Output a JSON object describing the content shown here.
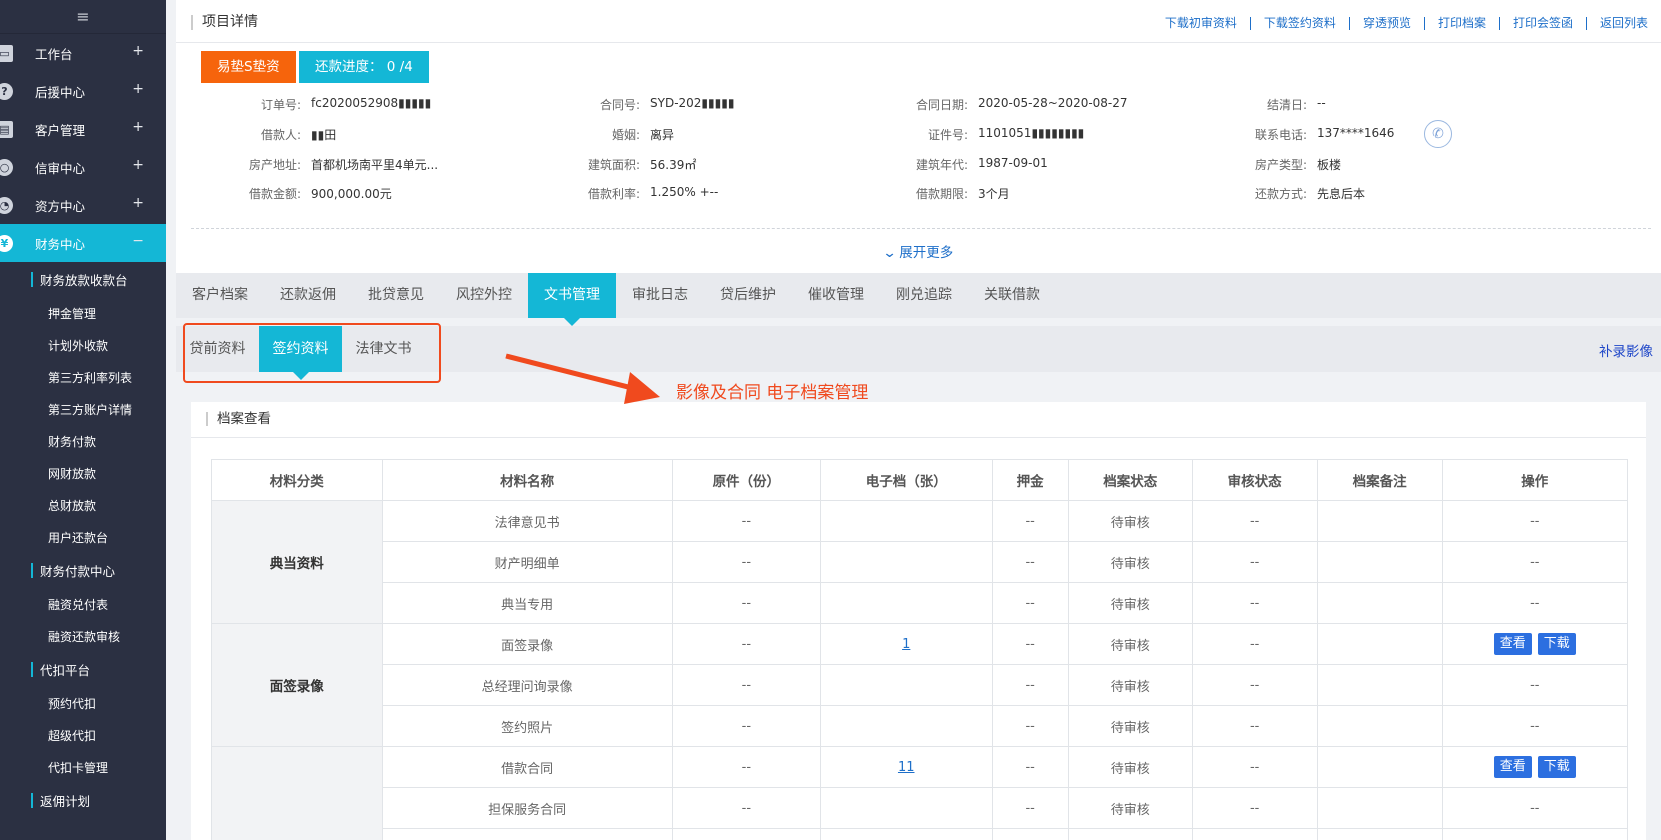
{
  "sidebar": {
    "toggle_icon": "hamburger-icon",
    "menus": [
      {
        "label": "工作台",
        "icon": "monitor-icon",
        "toggle": "+"
      },
      {
        "label": "后援中心",
        "icon": "question-icon",
        "toggle": "+"
      },
      {
        "label": "客户管理",
        "icon": "briefcase-icon",
        "toggle": "+"
      },
      {
        "label": "信审中心",
        "icon": "search-icon",
        "toggle": "+"
      },
      {
        "label": "资方中心",
        "icon": "pie-chart-icon",
        "toggle": "+"
      },
      {
        "label": "财务中心",
        "icon": "money-icon",
        "toggle": "−"
      }
    ],
    "groups": [
      {
        "label": "财务放款收款台",
        "items": [
          "押金管理",
          "计划外收款",
          "第三方利率列表",
          "第三方账户详情",
          "财务付款",
          "网财放款",
          "总财放款",
          "用户还款台"
        ]
      },
      {
        "label": "财务付款中心",
        "items": [
          "融资兑付表",
          "融资还款审核"
        ]
      },
      {
        "label": "代扣平台",
        "items": [
          "预约代扣",
          "超级代扣",
          "代扣卡管理"
        ]
      },
      {
        "label": "返佣计划",
        "items": []
      }
    ]
  },
  "header": {
    "title": "项目详情",
    "links": [
      "下载初审资料",
      "下载签约资料",
      "穿透预览",
      "打印档案",
      "打印会签函",
      "返回列表"
    ]
  },
  "tags": {
    "product": "易垫S垫资",
    "progress": "还款进度： 0 /4"
  },
  "info": {
    "row1": [
      {
        "label": "订单号:",
        "value": "fc2020052908▮▮▮▮▮"
      },
      {
        "label": "合同号:",
        "value": "SYD-202▮▮▮▮▮"
      },
      {
        "label": "合同日期:",
        "value": "2020-05-28~2020-08-27"
      },
      {
        "label": "结清日:",
        "value": "--"
      }
    ],
    "row2": [
      {
        "label": "借款人:",
        "value": "▮▮田"
      },
      {
        "label": "婚姻:",
        "value": "离异"
      },
      {
        "label": "证件号:",
        "value": "1101051▮▮▮▮▮▮▮▮"
      },
      {
        "label": "联系电话:",
        "value": "137****1646"
      }
    ],
    "row3": [
      {
        "label": "房产地址:",
        "value": "首都机场南平里4单元..."
      },
      {
        "label": "建筑面积:",
        "value": "56.39㎡"
      },
      {
        "label": "建筑年代:",
        "value": "1987-09-01"
      },
      {
        "label": "房产类型:",
        "value": "板楼"
      }
    ],
    "row4": [
      {
        "label": "借款金额:",
        "value": "900,000.00元"
      },
      {
        "label": "借款利率:",
        "value": "1.250% +--"
      },
      {
        "label": "借款期限:",
        "value": "3个月"
      },
      {
        "label": "还款方式:",
        "value": "先息后本"
      }
    ],
    "phone_icon": "phone-icon",
    "expand_label": "展开更多",
    "expand_icon": "chevron-down-icon"
  },
  "tabs": [
    "客户档案",
    "还款返佣",
    "批贷意见",
    "风控外控",
    "文书管理",
    "审批日志",
    "贷后维护",
    "催收管理",
    "刚兑追踪",
    "关联借款"
  ],
  "active_tab": "文书管理",
  "subtabs": [
    "贷前资料",
    "签约资料",
    "法律文书"
  ],
  "active_subtab": "签约资料",
  "supplement_label": "补录影像",
  "annotation": {
    "text": "影像及合同 电子档案管理",
    "color": "#f04a1e"
  },
  "archive": {
    "title": "档案查看",
    "columns": [
      "材料分类",
      "材料名称",
      "原件（份）",
      "电子档（张）",
      "押金",
      "档案状态",
      "审核状态",
      "档案备注",
      "操作"
    ],
    "groups": [
      {
        "category": "典当资料",
        "rows": [
          {
            "name": "法律意见书",
            "original": "--",
            "electronic": "",
            "deposit": "--",
            "status": "待审核",
            "review": "--",
            "note": "",
            "action": "--"
          },
          {
            "name": "财产明细单",
            "original": "--",
            "electronic": "",
            "deposit": "--",
            "status": "待审核",
            "review": "--",
            "note": "",
            "action": "--"
          },
          {
            "name": "典当专用",
            "original": "--",
            "electronic": "",
            "deposit": "--",
            "status": "待审核",
            "review": "--",
            "note": "",
            "action": "--"
          }
        ]
      },
      {
        "category": "面签录像",
        "rows": [
          {
            "name": "面签录像",
            "original": "--",
            "electronic": "1",
            "deposit": "--",
            "status": "待审核",
            "review": "--",
            "note": "",
            "action": "buttons"
          },
          {
            "name": "总经理问询录像",
            "original": "--",
            "electronic": "",
            "deposit": "--",
            "status": "待审核",
            "review": "--",
            "note": "",
            "action": "--"
          },
          {
            "name": "签约照片",
            "original": "--",
            "electronic": "",
            "deposit": "--",
            "status": "待审核",
            "review": "--",
            "note": "",
            "action": "--"
          }
        ]
      },
      {
        "category": "",
        "rows": [
          {
            "name": "借款合同",
            "original": "--",
            "electronic": "11",
            "deposit": "--",
            "status": "待审核",
            "review": "--",
            "note": "",
            "action": "buttons"
          },
          {
            "name": "担保服务合同",
            "original": "--",
            "electronic": "",
            "deposit": "--",
            "status": "待审核",
            "review": "--",
            "note": "",
            "action": "--"
          },
          {
            "name": "",
            "original": "",
            "electronic": "",
            "deposit": "",
            "status": "",
            "review": "",
            "note": "",
            "action": ""
          }
        ]
      }
    ],
    "view_label": "查看",
    "download_label": "下载"
  },
  "colors": {
    "sidebar_bg": "#2b3042",
    "accent": "#14b7d6",
    "orange": "#f6640c",
    "link": "#1e6fc9",
    "button": "#2c6fe0"
  }
}
